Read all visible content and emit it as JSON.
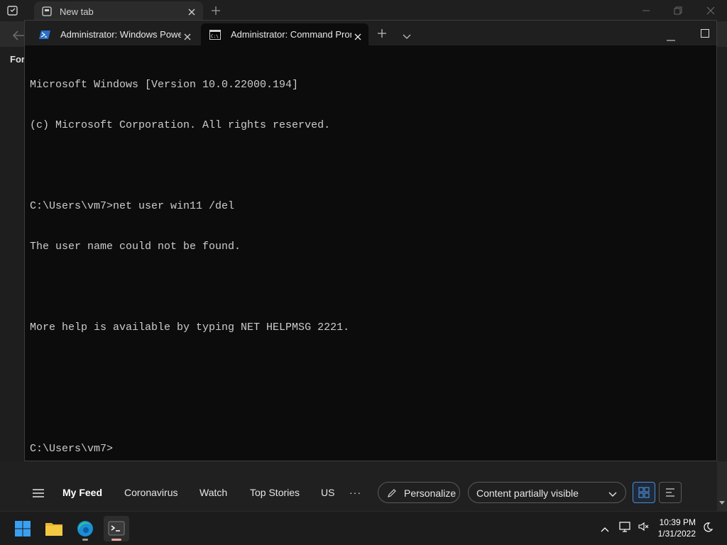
{
  "edge": {
    "tab_title": "New tab",
    "left_label": "For",
    "feed": {
      "nav": [
        "My Feed",
        "Coronavirus",
        "Watch",
        "Top Stories",
        "US"
      ],
      "more": "···",
      "personalize": "Personalize",
      "visibility": "Content partially visible"
    }
  },
  "terminal": {
    "tabs": [
      {
        "label": "Administrator: Windows PowerShell",
        "icon": "powershell-icon"
      },
      {
        "label": "Administrator: Command Prompt",
        "icon": "cmd-icon"
      }
    ],
    "lines": [
      "Microsoft Windows [Version 10.0.22000.194]",
      "(c) Microsoft Corporation. All rights reserved.",
      "",
      "C:\\Users\\vm7>net user win11 /del",
      "The user name could not be found.",
      "",
      "More help is available by typing NET HELPMSG 2221.",
      "",
      "",
      "C:\\Users\\vm7>"
    ]
  },
  "taskbar": {
    "apps": [
      "start",
      "file-explorer",
      "edge",
      "terminal"
    ],
    "time": "10:39 PM",
    "date": "1/31/2022"
  },
  "colors": {
    "terminal_bg": "#0c0c0c",
    "terminal_text": "#cccccc",
    "accent": "#4a8bd6"
  }
}
